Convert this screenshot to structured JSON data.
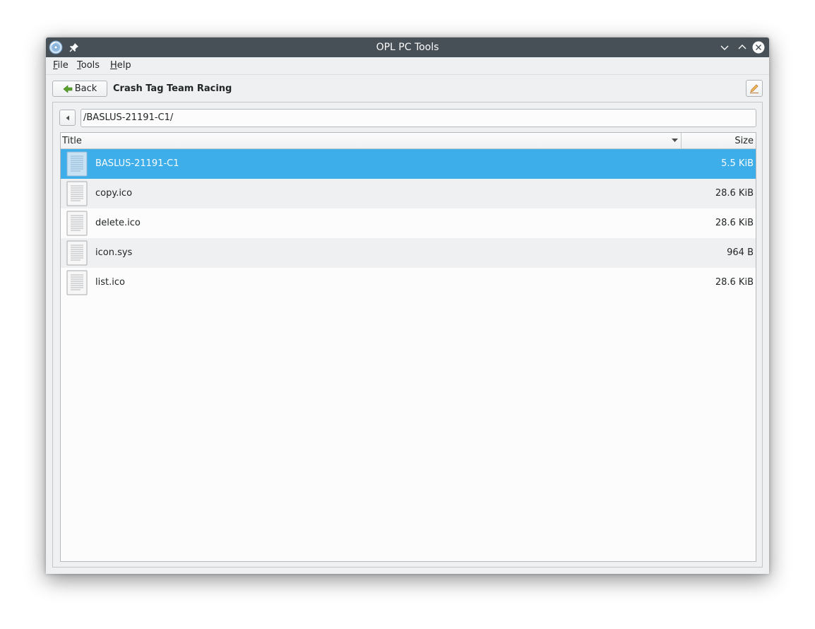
{
  "window": {
    "title": "OPL PC Tools"
  },
  "menubar": {
    "items": [
      {
        "accel": "F",
        "rest": "ile"
      },
      {
        "accel": "T",
        "rest": "ools"
      },
      {
        "accel": "H",
        "rest": "elp"
      }
    ]
  },
  "toolbar": {
    "back_label": "Back",
    "heading": "Crash Tag Team Racing"
  },
  "browser": {
    "path": "/BASLUS-21191-C1/",
    "columns": {
      "title": "Title",
      "size": "Size"
    },
    "files": [
      {
        "name": "BASLUS-21191-C1",
        "size": "5.5 KiB",
        "selected": true
      },
      {
        "name": "copy.ico",
        "size": "28.6 KiB",
        "selected": false
      },
      {
        "name": "delete.ico",
        "size": "28.6 KiB",
        "selected": false
      },
      {
        "name": "icon.sys",
        "size": "964 B",
        "selected": false
      },
      {
        "name": "list.ico",
        "size": "28.6 KiB",
        "selected": false
      }
    ]
  },
  "colors": {
    "titlebar": "#475057",
    "selection": "#3daee9",
    "back_arrow": "#5aa02c"
  },
  "icons": [
    "app-disc-icon",
    "pin-icon",
    "minimize-icon",
    "maximize-icon",
    "close-icon",
    "back-arrow-icon",
    "edit-pencil-icon",
    "navigate-up-icon",
    "sort-indicator-icon",
    "text-file-icon"
  ]
}
